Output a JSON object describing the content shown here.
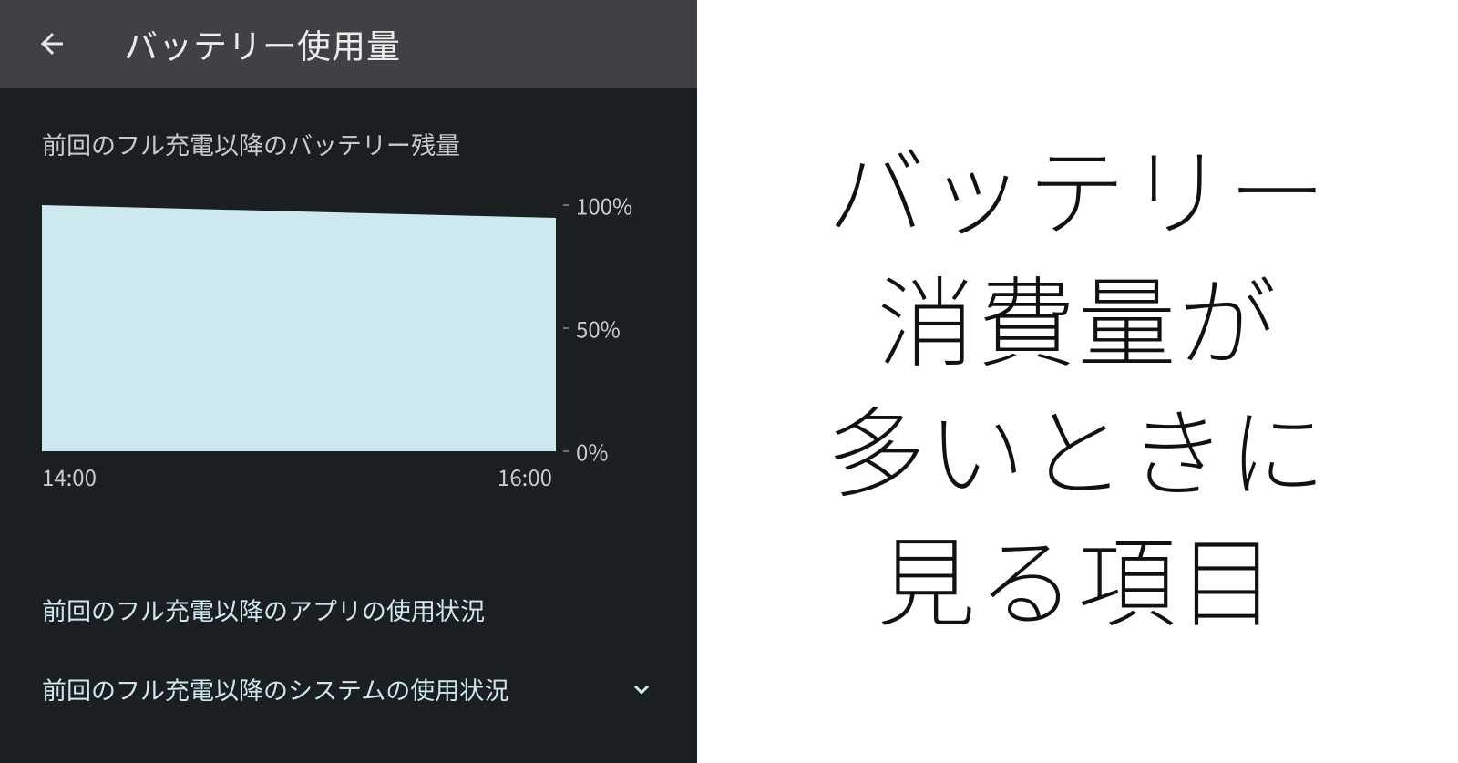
{
  "header": {
    "title": "バッテリー使用量"
  },
  "section": {
    "caption": "前回のフル充電以降のバッテリー残量"
  },
  "chart_data": {
    "type": "area",
    "x": [
      "14:00",
      "16:00"
    ],
    "values": [
      100,
      95
    ],
    "ylim": [
      0,
      100
    ],
    "yticks": [
      "100%",
      "50%",
      "0%"
    ],
    "xticks": [
      "14:00",
      "16:00"
    ],
    "title": "前回のフル充電以降のバッテリー残量",
    "xlabel": "",
    "ylabel": ""
  },
  "list": {
    "app_usage": "前回のフル充電以降のアプリの使用状況",
    "system_usage": "前回のフル充電以降のシステムの使用状況"
  },
  "annotation": {
    "line1": "バッテリー",
    "line2": "消費量が",
    "line3": "多いときに",
    "line4": "見る項目"
  }
}
